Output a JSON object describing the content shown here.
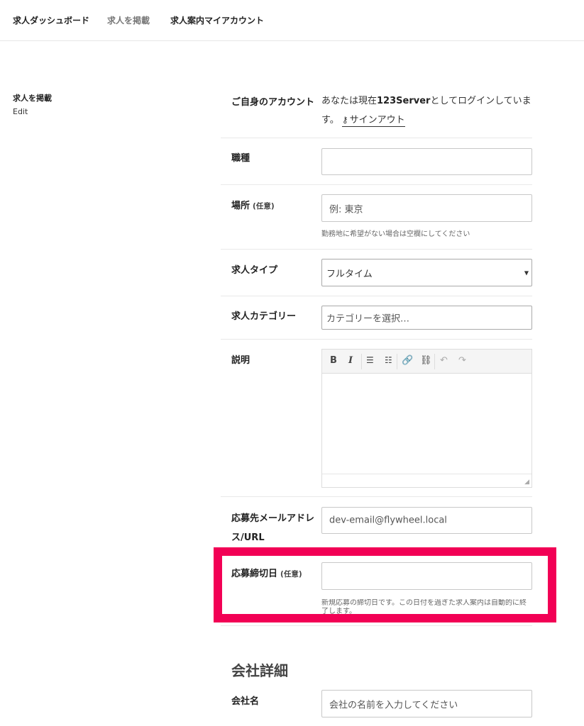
{
  "nav": {
    "dashboard": "求人ダッシュボード",
    "post": "求人を掲載",
    "account": "求人案内マイアカウント"
  },
  "sidebar": {
    "title": "求人を掲載",
    "subtitle": "Edit"
  },
  "form": {
    "account": {
      "label": "ご自身のアカウント",
      "text_prefix": "あなたは現在",
      "username": "123Server",
      "text_suffix": "としてログインしています。",
      "signout_label": "サインアウト"
    },
    "job_title": {
      "label": "職種",
      "value": ""
    },
    "location": {
      "label": "場所",
      "optional": "(任意)",
      "placeholder": "例: 東京",
      "help": "勤務地に希望がない場合は空欄にしてください"
    },
    "job_type": {
      "label": "求人タイプ",
      "selected": "フルタイム"
    },
    "job_category": {
      "label": "求人カテゴリー",
      "placeholder": "カテゴリーを選択…"
    },
    "description": {
      "label": "説明",
      "value": ""
    },
    "application": {
      "label_line1": "応募先メールアドレ",
      "label_line2": "ス/URL",
      "placeholder": "dev-email@flywheel.local"
    },
    "deadline": {
      "label": "応募締切日",
      "optional": "(任意)",
      "value": "",
      "help": "新規応募の締切日です。この日付を過ぎた求人案内は自動的に終了します。"
    }
  },
  "company": {
    "section_title": "会社詳細",
    "name": {
      "label": "会社名",
      "placeholder": "会社の名前を入力してください"
    }
  },
  "colors": {
    "highlight": "#f20055"
  }
}
